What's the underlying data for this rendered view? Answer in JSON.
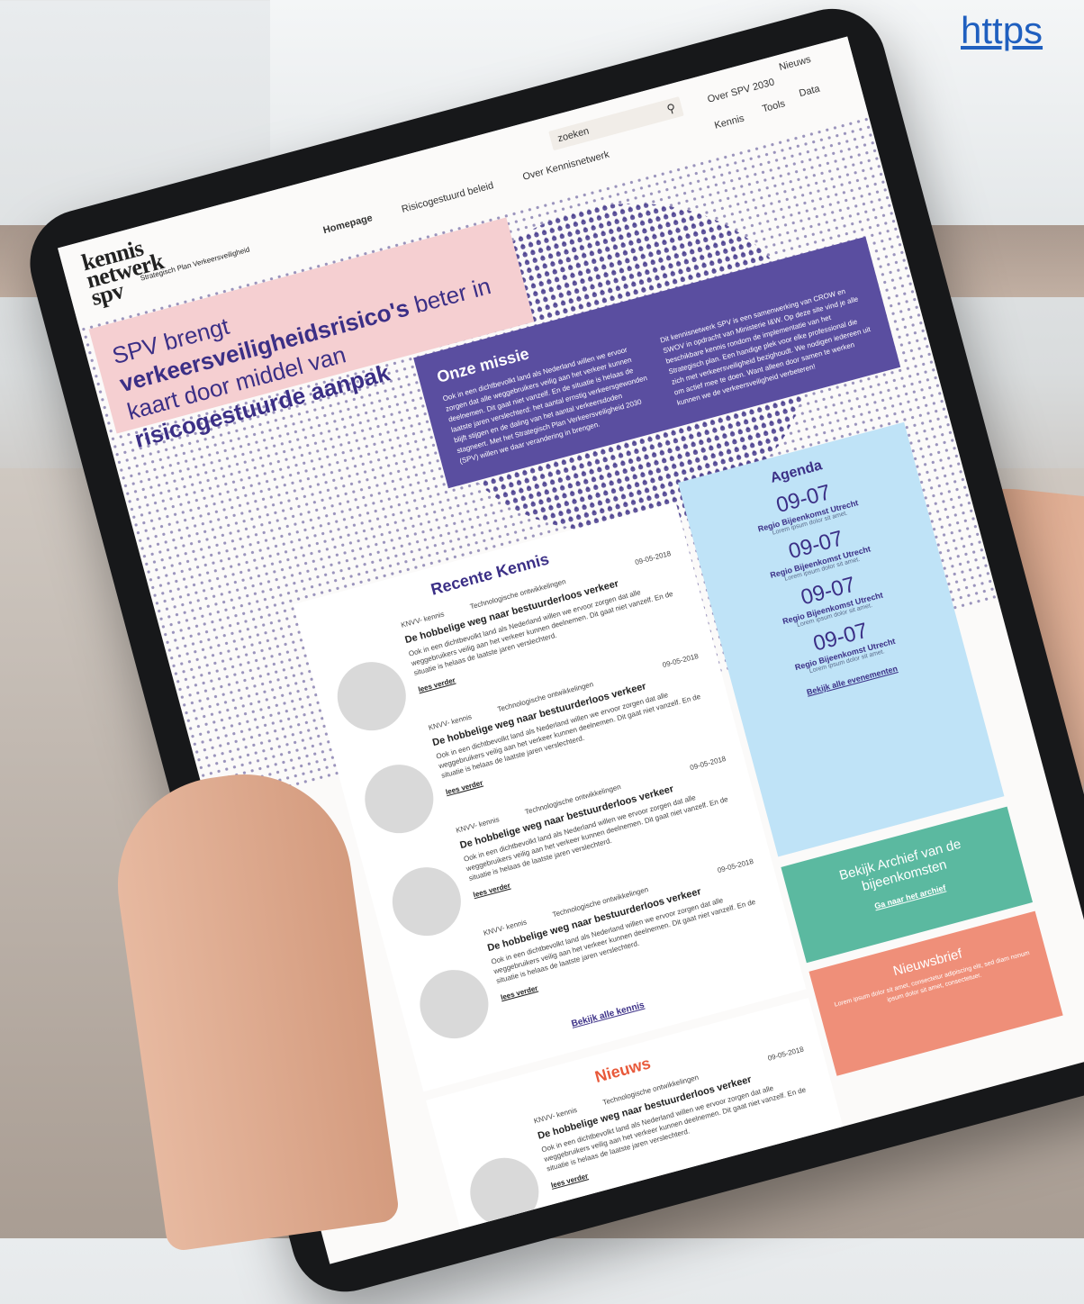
{
  "url_fragment": "https",
  "site": {
    "logo_words": [
      "kennis",
      "netwerk",
      "spv"
    ],
    "logo_sub": "Strategisch Plan Verkeersveiligheid"
  },
  "nav": {
    "items": [
      "Homepage",
      "Risicogestuurd beleid",
      "Over Kennisnetwerk"
    ],
    "search_placeholder": "zoeken",
    "secondary": [
      "Over SPV 2030",
      "Nieuws",
      "Kennis",
      "Tools",
      "Data"
    ]
  },
  "hero": {
    "pre": "SPV brengt ",
    "bold1": "verkeersveiligheidsrisico's",
    "mid": " beter in kaart door middel van ",
    "bold2": "risicogestuurde aanpak"
  },
  "missie": {
    "title": "Onze missie",
    "col1": "Ook in een dichtbevolkt land als Nederland willen we ervoor zorgen dat alle weggebruikers veilig aan het verkeer kunnen deelnemen. Dit gaat niet vanzelf. En de situatie is helaas de laatste jaren verslechterd: het aantal ernstig verkeersgewonden blijft stijgen en de daling van het aantal verkeersdoden stagneert. Met het Strategisch Plan Verkeersveiligheid 2030 (SPV) willen we daar verandering in brengen.",
    "col2": "Dit kennisnetwerk SPV is een samenwerking van CROW en SWOV in opdracht van Ministerie I&W. Op deze site vind je alle beschikbare kennis rondom de implementatie van het Strategisch plan. Een handige plek voor elke professional die zich met verkeersveiligheid bezighoudt. We nodigen iedereen uit om actief mee te doen. Want alleen door samen te werken kunnen we de verkeersveiligheid verbeteren!"
  },
  "kennis": {
    "title": "Recente Kennis",
    "items": [
      {
        "tag": "KNVV- kennis",
        "category": "Technologische ontwikkelingen",
        "date": "09-05-2018",
        "title": "De hobbelige weg naar bestuurderloos verkeer",
        "text": "Ook in een dichtbevolkt land als Nederland willen we ervoor zorgen dat alle weggebruikers veilig aan het verkeer kunnen deelnemen. Dit gaat niet vanzelf. En de situatie is helaas de laatste jaren verslechterd.",
        "link": "lees verder"
      },
      {
        "tag": "KNVV- kennis",
        "category": "Technologische ontwikkelingen",
        "date": "09-05-2018",
        "title": "De hobbelige weg naar bestuurderloos verkeer",
        "text": "Ook in een dichtbevolkt land als Nederland willen we ervoor zorgen dat alle weggebruikers veilig aan het verkeer kunnen deelnemen. Dit gaat niet vanzelf. En de situatie is helaas de laatste jaren verslechterd.",
        "link": "lees verder"
      },
      {
        "tag": "KNVV- kennis",
        "category": "Technologische ontwikkelingen",
        "date": "09-05-2018",
        "title": "De hobbelige weg naar bestuurderloos verkeer",
        "text": "Ook in een dichtbevolkt land als Nederland willen we ervoor zorgen dat alle weggebruikers veilig aan het verkeer kunnen deelnemen. Dit gaat niet vanzelf. En de situatie is helaas de laatste jaren verslechterd.",
        "link": "lees verder"
      },
      {
        "tag": "KNVV- kennis",
        "category": "Technologische ontwikkelingen",
        "date": "09-05-2018",
        "title": "De hobbelige weg naar bestuurderloos verkeer",
        "text": "Ook in een dichtbevolkt land als Nederland willen we ervoor zorgen dat alle weggebruikers veilig aan het verkeer kunnen deelnemen. Dit gaat niet vanzelf. En de situatie is helaas de laatste jaren verslechterd.",
        "link": "lees verder"
      }
    ],
    "all_link": "Bekijk alle kennis"
  },
  "nieuws": {
    "title": "Nieuws",
    "item": {
      "tag": "KNVV- kennis",
      "category": "Technologische ontwikkelingen",
      "date": "09-05-2018",
      "title": "De hobbelige weg naar bestuurderloos verkeer",
      "text": "Ook in een dichtbevolkt land als Nederland willen we ervoor zorgen dat alle weggebruikers veilig aan het verkeer kunnen deelnemen. Dit gaat niet vanzelf. En de situatie is helaas de laatste jaren verslechterd.",
      "link": "lees verder"
    }
  },
  "agenda": {
    "title": "Agenda",
    "events": [
      {
        "date": "09-07",
        "title": "Regio Bijeenkomst Utrecht",
        "sub": "Lorem ipsum dolor sit amet."
      },
      {
        "date": "09-07",
        "title": "Regio Bijeenkomst Utrecht",
        "sub": "Lorem ipsum dolor sit amet."
      },
      {
        "date": "09-07",
        "title": "Regio Bijeenkomst Utrecht",
        "sub": "Lorem ipsum dolor sit amet."
      },
      {
        "date": "09-07",
        "title": "Regio Bijeenkomst Utrecht",
        "sub": "Lorem ipsum dolor sit amet."
      }
    ],
    "all_link": "Bekijk alle evenementen"
  },
  "archief": {
    "title": "Bekijk Archief van de bijeenkomsten",
    "link": "Ga naar het archief"
  },
  "nieuwsbrief": {
    "title": "Nieuwsbrief",
    "text": "Lorem ipsum dolor sit amet, consectetur adipiscing elit, sed diam nonum ipsum dolor sit amet, consectetuer."
  },
  "colors": {
    "purple": "#3b2f86",
    "pink": "#f5cfd1",
    "blue": "#bfe3f7",
    "teal": "#5bb9a0",
    "coral": "#ef8f79",
    "orange_title": "#e8593a"
  }
}
